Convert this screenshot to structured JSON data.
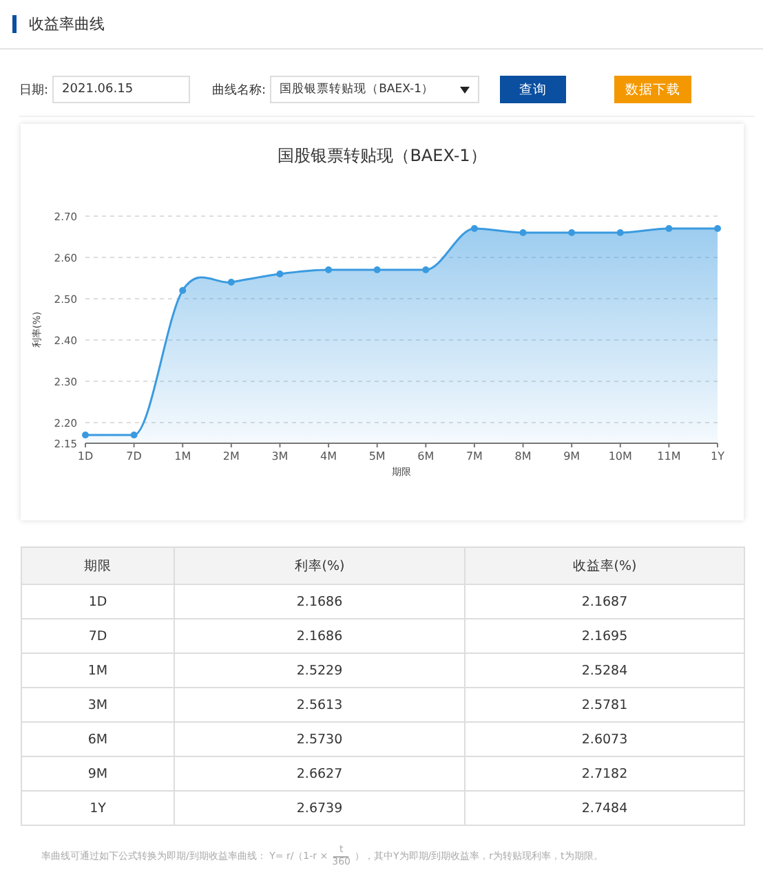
{
  "page_title": "收益率曲线",
  "form": {
    "date_label": "日期:",
    "date_value": "2021.06.15",
    "curve_label": "曲线名称:",
    "curve_value": "国股银票转贴现（BAEX-1）",
    "query_button": "查询",
    "download_button": "数据下载"
  },
  "chart": {
    "chart_data": {
      "type": "area",
      "title": "国股银票转贴现（BAEX-1）",
      "xlabel": "期限",
      "ylabel": "利率(%)",
      "categories": [
        "1D",
        "7D",
        "1M",
        "2M",
        "3M",
        "4M",
        "5M",
        "6M",
        "7M",
        "8M",
        "9M",
        "10M",
        "11M",
        "1Y"
      ],
      "series": [
        {
          "color": "#3a9ae0",
          "values": [
            2.17,
            2.17,
            2.52,
            2.54,
            2.56,
            2.57,
            2.57,
            2.57,
            2.67,
            2.66,
            2.66,
            2.66,
            2.67,
            2.67
          ]
        }
      ],
      "grid": true,
      "ylim": [
        2.15,
        2.7
      ],
      "yticks": [
        2.15,
        {
          "value": 2.2,
          "label": "2.20"
        },
        {
          "value": 2.3,
          "label": "2.30"
        },
        {
          "value": 2.4,
          "label": "2.40"
        },
        {
          "value": 2.5,
          "label": "2.50"
        },
        {
          "value": 2.6,
          "label": "2.60"
        },
        {
          "value": 2.7,
          "label": "2.70"
        }
      ]
    }
  },
  "table": {
    "columns": [
      "期限",
      "利率(%)",
      "收益率(%)"
    ],
    "rows": [
      [
        "1D",
        "2.1686",
        "2.1687"
      ],
      [
        "7D",
        "2.1686",
        "2.1695"
      ],
      [
        "1M",
        "2.5229",
        "2.5284"
      ],
      [
        "3M",
        "2.5613",
        "2.5781"
      ],
      [
        "6M",
        "2.5730",
        "2.6073"
      ],
      [
        "9M",
        "2.6627",
        "2.7182"
      ],
      [
        "1Y",
        "2.6739",
        "2.7484"
      ]
    ]
  },
  "footnote": {
    "before": "率曲线可通过如下公式转换为即期/到期收益率曲线：  Y= r/（1-r ×",
    "numerator": "t",
    "denominator": "360",
    "after": "），其中Y为即期/到期收益率，r为转贴现利率，t为期限。"
  }
}
